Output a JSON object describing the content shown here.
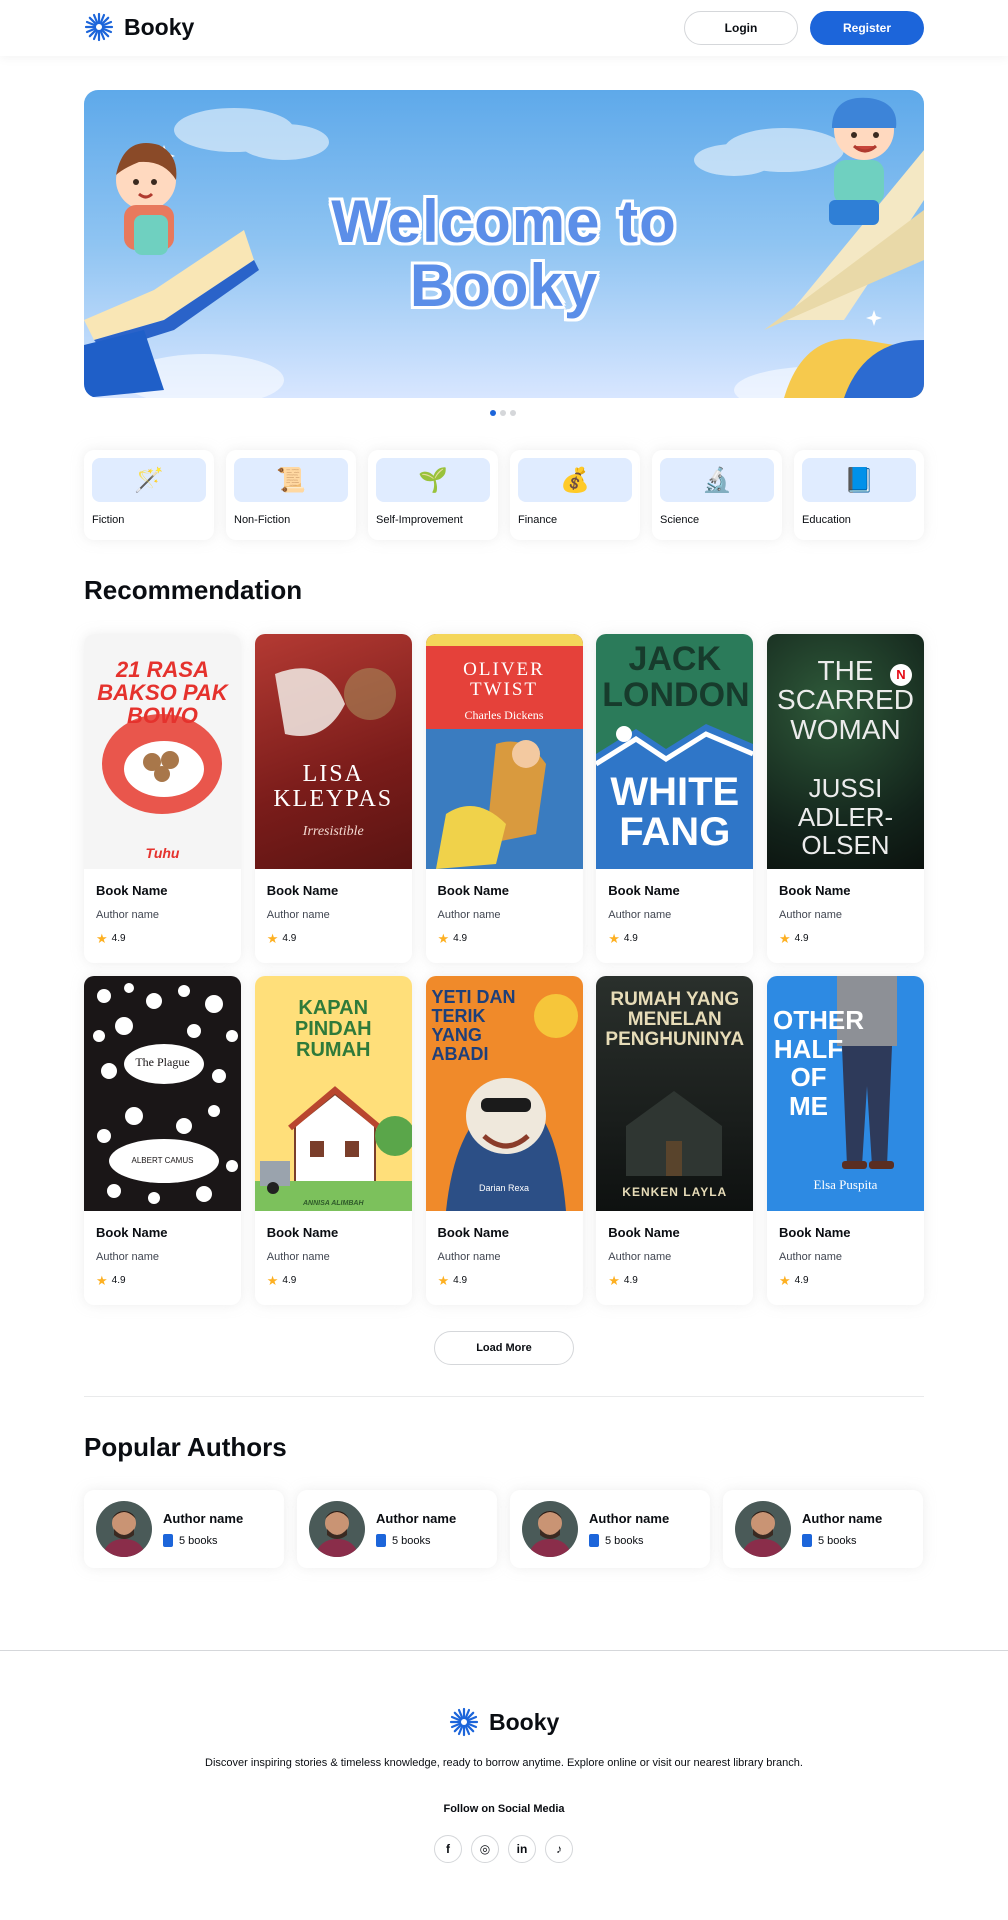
{
  "header": {
    "brand": "Booky",
    "login_label": "Login",
    "register_label": "Register"
  },
  "hero": {
    "title": "Welcome to Booky",
    "slides": 3,
    "active_slide": 1
  },
  "categories": [
    {
      "label": "Fiction",
      "icon": "magic-wand-icon"
    },
    {
      "label": "Non-Fiction",
      "icon": "scroll-icon"
    },
    {
      "label": "Self-Improvement",
      "icon": "sprout-icon"
    },
    {
      "label": "Finance",
      "icon": "money-bag-icon"
    },
    {
      "label": "Science",
      "icon": "microscope-icon"
    },
    {
      "label": "Education",
      "icon": "book-icon"
    }
  ],
  "recommendation": {
    "title": "Recommendation",
    "load_more_label": "Load More",
    "books": [
      {
        "name": "Book Name",
        "author": "Author name",
        "rating": "4.9",
        "cover_title": "21 RASA BAKSO PAK BOWO",
        "cover_author": "Tuhu"
      },
      {
        "name": "Book Name",
        "author": "Author name",
        "rating": "4.9",
        "cover_title": "LISA KLEYPAS",
        "cover_author": "Irresistible"
      },
      {
        "name": "Book Name",
        "author": "Author name",
        "rating": "4.9",
        "cover_title": "OLIVER TWIST",
        "cover_author": "Charles Dickens"
      },
      {
        "name": "Book Name",
        "author": "Author name",
        "rating": "4.9",
        "cover_title": "JACK LONDON",
        "cover_author": "WHITE FANG"
      },
      {
        "name": "Book Name",
        "author": "Author name",
        "rating": "4.9",
        "cover_title": "THE SCARRED WOMAN",
        "cover_author": "JUSSI ADLER-OLSEN"
      },
      {
        "name": "Book Name",
        "author": "Author name",
        "rating": "4.9",
        "cover_title": "The Plague",
        "cover_author": "ALBERT CAMUS"
      },
      {
        "name": "Book Name",
        "author": "Author name",
        "rating": "4.9",
        "cover_title": "KAPAN PINDAH RUMAH",
        "cover_author": "ANNISA ALIMBAH"
      },
      {
        "name": "Book Name",
        "author": "Author name",
        "rating": "4.9",
        "cover_title": "YETI DAN TERIK YANG ABADI",
        "cover_author": "Darian Rexa"
      },
      {
        "name": "Book Name",
        "author": "Author name",
        "rating": "4.9",
        "cover_title": "RUMAH YANG MENELAN PENGHUNINYA",
        "cover_author": "KENKEN LAYLA"
      },
      {
        "name": "Book Name",
        "author": "Author name",
        "rating": "4.9",
        "cover_title": "OTHER HALF OF ME",
        "cover_author": "Elsa Puspita"
      }
    ]
  },
  "popular_authors": {
    "title": "Popular Authors",
    "authors": [
      {
        "name": "Author name",
        "books": "5 books"
      },
      {
        "name": "Author name",
        "books": "5 books"
      },
      {
        "name": "Author name",
        "books": "5 books"
      },
      {
        "name": "Author name",
        "books": "5 books"
      }
    ]
  },
  "footer": {
    "brand": "Booky",
    "description": "Discover inspiring stories & timeless knowledge, ready to borrow anytime. Explore online or visit our nearest library branch.",
    "follow_label": "Follow on Social Media",
    "socials": [
      {
        "icon": "facebook-icon",
        "glyph": "f"
      },
      {
        "icon": "instagram-icon",
        "glyph": "◎"
      },
      {
        "icon": "linkedin-icon",
        "glyph": "in"
      },
      {
        "icon": "tiktok-icon",
        "glyph": "♪"
      }
    ]
  },
  "colors": {
    "primary": "#1c65da",
    "text": "#0a0d12",
    "muted": "#414651",
    "star": "#fdb022",
    "category_tile": "#e0ecff"
  }
}
